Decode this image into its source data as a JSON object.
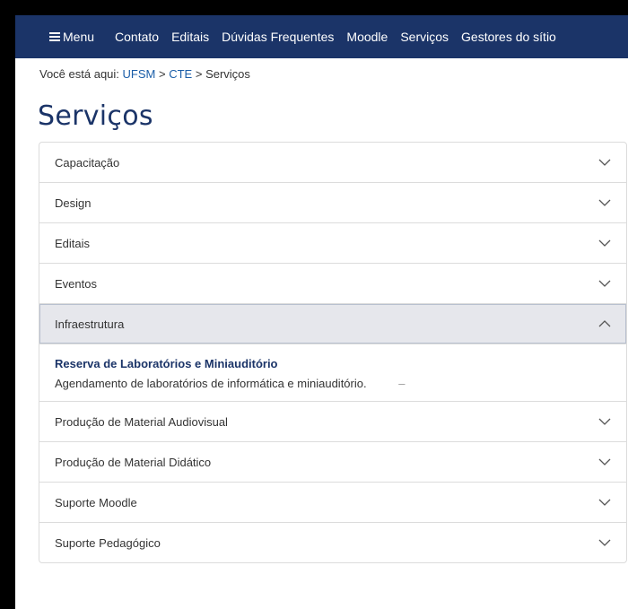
{
  "nav": {
    "menu_label": "Menu",
    "links": [
      "Contato",
      "Editais",
      "Dúvidas Frequentes",
      "Moodle",
      "Serviços",
      "Gestores do sítio"
    ]
  },
  "breadcrumb": {
    "prefix": "Você está aqui:",
    "items": [
      "UFSM",
      "CTE",
      "Serviços"
    ],
    "separator": ">"
  },
  "page": {
    "title": "Serviços"
  },
  "accordion": {
    "items": [
      {
        "label": "Capacitação"
      },
      {
        "label": "Design"
      },
      {
        "label": "Editais"
      },
      {
        "label": "Eventos"
      },
      {
        "label": "Infraestrutura",
        "expanded": true,
        "entries": [
          {
            "title": "Reserva de Laboratórios e Miniauditório",
            "description": "Agendamento de laboratórios de informática e miniauditório.",
            "trailing_mark": "–"
          }
        ]
      },
      {
        "label": "Produção de Material Audiovisual"
      },
      {
        "label": "Produção de Material Didático"
      },
      {
        "label": "Suporte Moodle"
      },
      {
        "label": "Suporte Pedagógico"
      }
    ]
  },
  "colors": {
    "nav_bg": "#1b3468",
    "title": "#1b3468",
    "link": "#1b5ea8",
    "open_header_bg": "#e6e7ec"
  },
  "icons": {
    "menu": "hamburger-icon",
    "collapsed": "chevron-down-icon",
    "expanded": "chevron-up-icon"
  }
}
